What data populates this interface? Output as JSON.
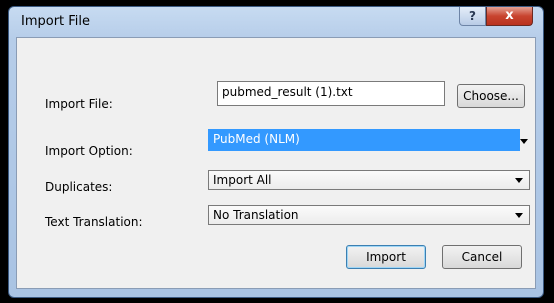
{
  "window": {
    "title": "Import File",
    "help_glyph": "?",
    "close_glyph": "x"
  },
  "form": {
    "import_file_label": "Import File:",
    "import_file_value": "pubmed_result (1).txt",
    "choose_label": "Choose...",
    "import_option_label": "Import Option:",
    "import_option_value": "PubMed (NLM)",
    "duplicates_label": "Duplicates:",
    "duplicates_value": "Import All",
    "text_translation_label": "Text Translation:",
    "text_translation_value": "No Translation"
  },
  "buttons": {
    "import_label": "Import",
    "cancel_label": "Cancel"
  },
  "colors": {
    "selection": "#3399ff",
    "close_button": "#c8442f"
  },
  "icons": [
    "help-icon",
    "close-icon",
    "dropdown-arrow-icon"
  ]
}
